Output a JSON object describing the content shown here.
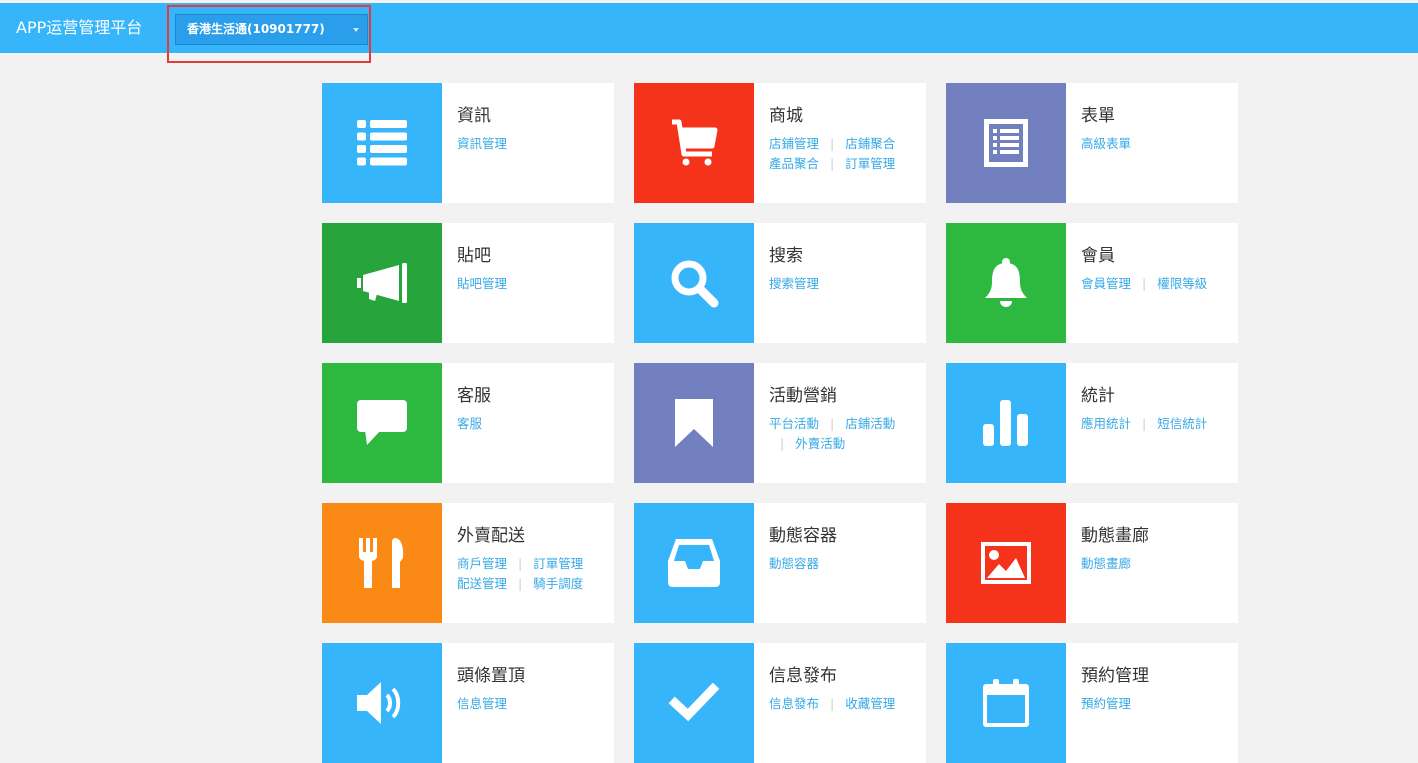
{
  "header": {
    "title": "APP运营管理平台",
    "app_selector": "香港生活通(10901777)"
  },
  "colors": {
    "topbar": "#36b5fb",
    "blue": "#36b5fb",
    "red": "#f5331a",
    "purple": "#7380bf",
    "dark_green": "#27a43b",
    "green": "#2db940",
    "orange": "#fb8915",
    "highlight": "#e6393a"
  },
  "tiles": [
    {
      "title": "資訊",
      "icon": "list-icon",
      "color": "blue",
      "links": [
        [
          "資訊管理"
        ]
      ]
    },
    {
      "title": "商城",
      "icon": "shopping-cart-icon",
      "color": "red",
      "links": [
        [
          "店鋪管理",
          "店鋪聚合"
        ],
        [
          "產品聚合",
          "訂單管理"
        ]
      ]
    },
    {
      "title": "表單",
      "icon": "form-icon",
      "color": "purple",
      "links": [
        [
          "高級表單"
        ]
      ]
    },
    {
      "title": "貼吧",
      "icon": "megaphone-icon",
      "color": "dark_green",
      "links": [
        [
          "貼吧管理"
        ]
      ]
    },
    {
      "title": "搜索",
      "icon": "search-icon",
      "color": "blue",
      "links": [
        [
          "搜索管理"
        ]
      ]
    },
    {
      "title": "會員",
      "icon": "bell-icon",
      "color": "green",
      "links": [
        [
          "會員管理",
          "權限等級"
        ]
      ]
    },
    {
      "title": "客服",
      "icon": "chat-bubble-icon",
      "color": "green",
      "links": [
        [
          "客服"
        ]
      ]
    },
    {
      "title": "活動營銷",
      "icon": "bookmark-icon",
      "color": "purple",
      "links": [
        [
          "平台活動",
          "店鋪活動"
        ],
        [
          "",
          "外賣活動"
        ]
      ]
    },
    {
      "title": "統計",
      "icon": "bar-chart-icon",
      "color": "blue",
      "links": [
        [
          "應用統計",
          "短信統計"
        ]
      ]
    },
    {
      "title": "外賣配送",
      "icon": "cutlery-icon",
      "color": "orange",
      "links": [
        [
          "商戶管理",
          "訂單管理"
        ],
        [
          "配送管理",
          "騎手調度"
        ]
      ]
    },
    {
      "title": "動態容器",
      "icon": "inbox-icon",
      "color": "blue",
      "links": [
        [
          "動態容器"
        ]
      ]
    },
    {
      "title": "動態畫廊",
      "icon": "picture-icon",
      "color": "red",
      "links": [
        [
          "動態畫廊"
        ]
      ]
    },
    {
      "title": "頭條置頂",
      "icon": "volume-icon",
      "color": "blue",
      "links": [
        [
          "信息管理"
        ]
      ]
    },
    {
      "title": "信息發布",
      "icon": "check-icon",
      "color": "blue",
      "links": [
        [
          "信息發布",
          "收藏管理"
        ]
      ]
    },
    {
      "title": "預約管理",
      "icon": "calendar-icon",
      "color": "blue",
      "links": [
        [
          "預約管理"
        ]
      ]
    }
  ]
}
